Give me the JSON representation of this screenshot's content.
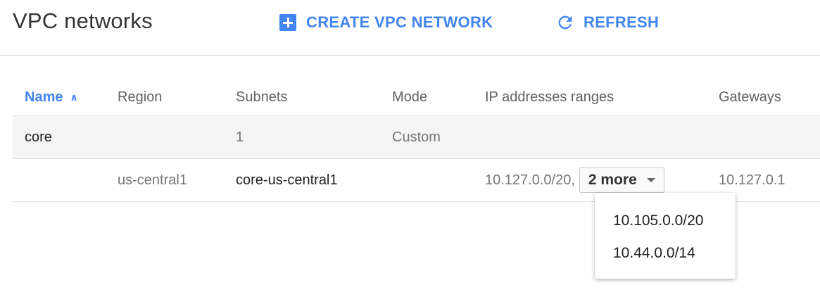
{
  "header": {
    "title": "VPC networks",
    "create_label": "CREATE VPC NETWORK",
    "refresh_label": "REFRESH",
    "accent_color": "#4285f4",
    "icons": {
      "create": "add-box-icon",
      "refresh": "refresh-icon"
    }
  },
  "table": {
    "columns": {
      "name": "Name",
      "region": "Region",
      "subnets": "Subnets",
      "mode": "Mode",
      "ip_ranges": "IP addresses ranges",
      "gateways": "Gateways"
    },
    "sort": {
      "column": "Name",
      "direction": "ascending",
      "icon": "sort-ascending-icon"
    },
    "network": {
      "name": "core",
      "subnets": "1",
      "mode": "Custom"
    },
    "subnet": {
      "region": "us-central1",
      "name": "core-us-central1",
      "ip_primary": "10.127.0.0/20,",
      "more_label": "2 more",
      "gateway": "10.127.0.1"
    }
  },
  "ip_dropdown": {
    "items": [
      "10.105.0.0/20",
      "10.44.0.0/14"
    ]
  }
}
